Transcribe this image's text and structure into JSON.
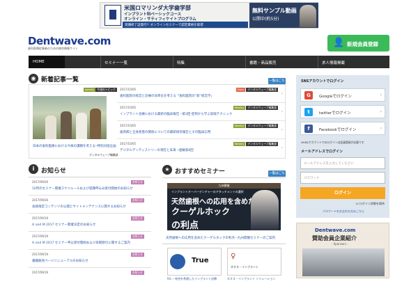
{
  "banner": {
    "title": "米国ロマリンダ大学歯学部",
    "sub1": "インプラント科ベーシックコース",
    "sub2": "オンライン・サティフィケイトプログラム",
    "bar": "受講修了証発行!! オンラインセミナーで認定資格を取得",
    "video1": "無料サンプル動画",
    "video2": "公開中(約5分)"
  },
  "logo": {
    "text": "Dentwave.com",
    "sub": "歯科医療従事者のための総合情報サイト"
  },
  "register": {
    "label": "新規会員登録",
    "icon": "add-user-icon"
  },
  "nav": {
    "items": [
      "HOME",
      "セミナー一覧",
      "特集",
      "書籍・商品販売",
      "求人情報掲載"
    ]
  },
  "new_articles": {
    "title": "新着記事一覧",
    "more": "一覧はこちら",
    "featured": {
      "tags": [
        "weekly",
        "今週のトピック"
      ],
      "title": "日本の歯科医療における今後の課題を考える─特別対談企画",
      "author": "デンタルウェーブ編集部"
    },
    "items": [
      {
        "date": "2017/10/05",
        "title": "歯科医院の経営と診療の効率化を考える「歯科医院の“新”経営学」",
        "tags": [
          "Daily",
          "デンタルウェーブ編集部"
        ]
      },
      {
        "date": "2017/10/05",
        "title": "インプラント治療における最新の臨床報告 ─第3回 症例から学ぶ実践テクニック",
        "tags": [
          "Weekly",
          "デンタルウェーブ編集部"
        ]
      },
      {
        "date": "2017/10/05",
        "title": "歯周病と全身疾患の関係についての最新研究報告とその臨床応用",
        "tags": [
          "Weekly",
          "デンタルウェーブ編集部"
        ]
      },
      {
        "date": "2017/10/05",
        "title": "デジタルデンティストリーの現在と未来 ─連載第8回",
        "tags": [
          "Weekly",
          "デンタルウェーブ編集部"
        ]
      }
    ]
  },
  "info": {
    "title": "お知らせ",
    "items": [
      {
        "date": "2017/09/26",
        "title": "10月のセミナー開催スケジュールおよび受講申込み受付開始のお知らせ",
        "tag": "お知らせ"
      },
      {
        "date": "2017/09/26",
        "title": "会員限定コンテンツの公開とサイトメンテナンスに関するお知らせ",
        "tag": "お知らせ"
      },
      {
        "date": "2017/09/19",
        "title": "H and M 2017 セミナー開催決定のお知らせ",
        "tag": "お知らせ"
      },
      {
        "date": "2017/09/19",
        "title": "H and M 2017 セミナー申込受付開始および早期割引に関するご案内",
        "tag": "お知らせ"
      },
      {
        "date": "2017/09/19",
        "title": "書籍販売ページリニューアルのお知らせ",
        "tag": "お知らせ"
      },
      {
        "date": "2017/09/19",
        "title": "",
        "tag": "お知らせ"
      }
    ]
  },
  "seminar": {
    "title": "おすすめセミナー",
    "more": "一覧はこちら",
    "image": {
      "top": "九州開催",
      "line1": "インプラントオーバーデンチャーのアタッチメントの選択",
      "line2": "天然歯根への応用を含めた",
      "line3": "クーゲルホック",
      "line4": "の利点"
    },
    "caption": "天然歯根への応用を含めたクーゲルホックの利点 ─九州開催セミナーのご案内",
    "thumbs": [
      {
        "label": "True",
        "caption": "IVL ─ 咬合を考慮したインプラント治療"
      },
      {
        "label": "ネオス・インプラント",
        "caption": "ネオス・インプラント ソリューション"
      }
    ]
  },
  "sidebar": {
    "sns_title": "SNSアカウントでログイン",
    "sns": [
      {
        "label": "Googleでログイン",
        "icon": "google-icon",
        "color": "#dd4b39",
        "glyph": "G"
      },
      {
        "label": "twitterでログイン",
        "icon": "twitter-icon",
        "color": "#1da1f2",
        "glyph": "t"
      },
      {
        "label": "Facebookでログイン",
        "icon": "facebook-icon",
        "color": "#3b5998",
        "glyph": "f"
      }
    ],
    "sns_note": "※SNSアカウントでのログインは会員登録が必要です",
    "login_title": "メールアドレスでログイン",
    "email_placeholder": "メールアドレスを入力してください",
    "password_placeholder": "パスワード",
    "login_button": "ログイン",
    "remember": "ログイン状態を保持",
    "forgot": "パスワードをお忘れの方はこちら"
  },
  "sponsor": {
    "logo": "Dentwave.com",
    "title": "賛助会員企業紹介",
    "sub": "- Sponsors -"
  }
}
